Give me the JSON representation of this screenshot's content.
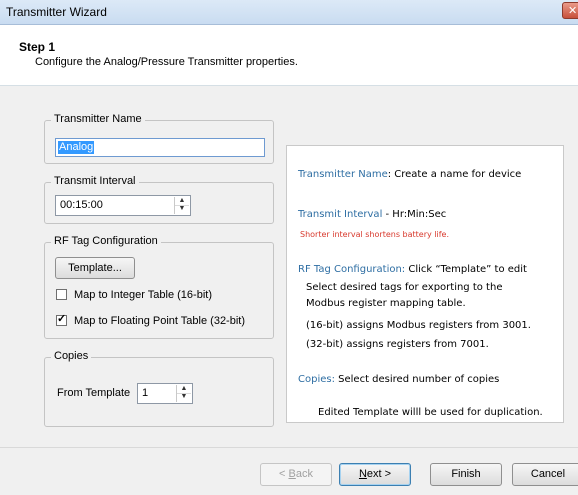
{
  "window": {
    "title": "Transmitter Wizard",
    "close_glyph": "✕"
  },
  "header": {
    "step": "Step 1",
    "description": "Configure the Analog/Pressure Transmitter properties."
  },
  "transmitter_name": {
    "legend": "Transmitter Name",
    "value": "Analog"
  },
  "transmit_interval": {
    "legend": "Transmit Interval",
    "value": "00:15:00"
  },
  "rf_tag": {
    "legend": "RF Tag Configuration",
    "template_button": "Template...",
    "map_integer": {
      "label": "Map to Integer Table (16-bit)",
      "checked": false
    },
    "map_float": {
      "label": "Map to Floating Point Table (32-bit)",
      "checked": true
    }
  },
  "copies": {
    "legend": "Copies",
    "from_template_label": "From Template",
    "value": "1"
  },
  "help": {
    "name_title": "Transmitter Name",
    "name_text": ": Create a name for device",
    "interval_title": "Transmit Interval",
    "interval_text": " - Hr:Min:Sec",
    "interval_warning": "Shorter interval shortens battery life.",
    "rf_title": "RF Tag Configuration:",
    "rf_text": " Click “Template” to edit",
    "rf_line1": "Select desired tags for exporting to the",
    "rf_line2": "Modbus register mapping table.",
    "rf_16bit": "(16-bit) assigns Modbus registers from 3001.",
    "rf_32bit": "(32-bit) assigns registers from 7001.",
    "copies_title": "Copies:",
    "copies_text": " Select desired number of copies",
    "copies_note": "Edited Template willl be used for duplication."
  },
  "buttons": {
    "back_prefix": "< ",
    "back_mnemonic": "B",
    "back_rest": "ack",
    "next_mnemonic": "N",
    "next_rest": "ext >",
    "finish": "Finish",
    "cancel": "Cancel"
  },
  "colors": {
    "help_title": "#2e6ea3",
    "warning": "#d83a2e",
    "selection": "#3399ff"
  },
  "icons": {
    "spin_up": "up-arrow-icon",
    "spin_down": "down-arrow-icon",
    "check": "checkmark-icon",
    "close": "close-icon"
  }
}
